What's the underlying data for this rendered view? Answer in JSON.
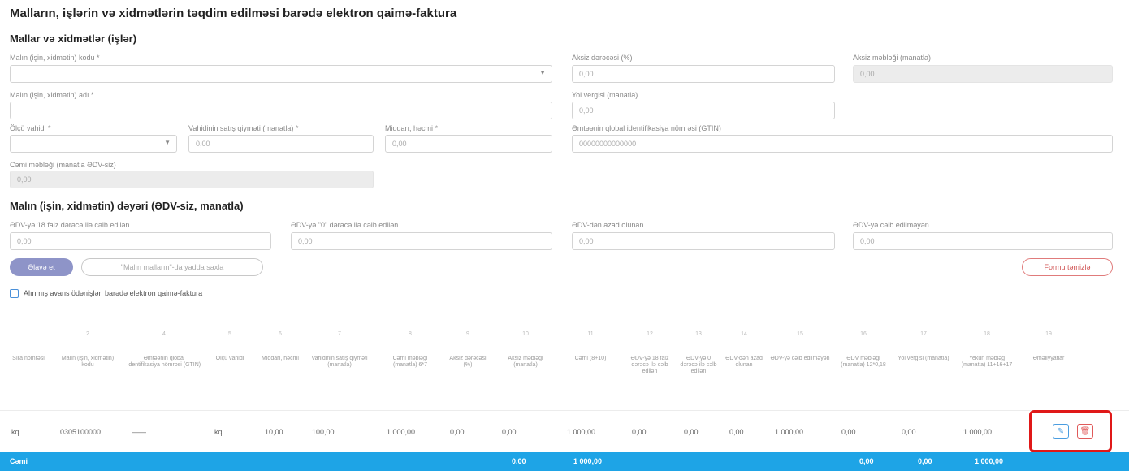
{
  "page_title": "Malların, işlərin və xidmətlərin təqdim edilməsi barədə elektron qaimə-faktura",
  "section1_title": "Mallar və xidmətlər (işlər)",
  "section2_title": "Malın (işin, xidmətin) dəyəri (ƏDV-siz, manatla)",
  "fields": {
    "code_label": "Malın (işin, xidmətin) kodu *",
    "discount_rate_label": "Aksiz dərəcəsi (%)",
    "discount_rate_value": "0,00",
    "discount_amount_label": "Aksiz məbləği (manatla)",
    "discount_amount_value": "0,00",
    "name_label": "Malın (işin, xidmətin) adı *",
    "road_tax_label": "Yol vergisi (manatla)",
    "road_tax_value": "0,00",
    "unit_label": "Ölçü vahidi *",
    "unit_price_label": "Vahidinin satış qiyməti (manatla) *",
    "unit_price_value": "0,00",
    "quantity_label": "Miqdarı, həcmi *",
    "quantity_value": "0,00",
    "gtin_label": "Əmtəənin qlobal identifikasiya nömrəsi (GTIN)",
    "gtin_value": "00000000000000",
    "total_label": "Cəmi məbləği (manatla ƏDV-siz)",
    "total_value": "0,00",
    "vat18_label": "ƏDV-yə 18 faiz dərəcə ilə cəlb edilən",
    "vat18_value": "0,00",
    "vat0_label": "ƏDV-yə \"0\" dərəcə ilə cəlb edilən",
    "vat0_value": "0,00",
    "vat_exempt_label": "ƏDV-dən azad olunan",
    "vat_exempt_value": "0,00",
    "vat_not_label": "ƏDV-yə cəlb edilməyən",
    "vat_not_value": "0,00"
  },
  "buttons": {
    "add": "Əlavə et",
    "list": "\"Malın malların\"-da yadda saxla",
    "clear": "Formu təmizlə"
  },
  "checkbox_label": "Alınmış avans ödənişləri barədə elektron qaimə-faktura",
  "table": {
    "col_numbers": [
      "2",
      "4",
      "5",
      "6",
      "7",
      "8",
      "9",
      "10",
      "11",
      "12",
      "13",
      "14",
      "15",
      "16",
      "17",
      "18",
      "19"
    ],
    "headers": [
      "Sıra nömrəsi",
      "Malın (işin, xidmətin) kodu",
      "Əmtəənin qlobal identifikasiya nömrəsi (GTIN)",
      "Ölçü vahidi",
      "Miqdarı, həcmi",
      "Vahidinin satış qiyməti (manatla)",
      "Cəmi məbləği (manatla) 6*7",
      "Aksiz dərəcəsi (%)",
      "Aksiz məbləği (manatla)",
      "Cəmi (8+10)",
      "ƏDV-yə 18 faiz dərəcə ilə cəlb edilən",
      "ƏDV-yə 0 dərəcə ilə cəlb edilən",
      "ƏDV-dən azad olunan",
      "ƏDV-yə cəlb edilməyən",
      "ƏDV məbləği (manatla) 12*0,18",
      "Yol vergisi (manatla)",
      "Yekun məbləğ (manatla) 11+16+17",
      "Əməliyyatlar"
    ],
    "row": [
      "kq",
      "0305100000",
      "——",
      "kq",
      "10,00",
      "100,00",
      "1 000,00",
      "0,00",
      "0,00",
      "1 000,00",
      "0,00",
      "0,00",
      "0,00",
      "1 000,00",
      "0,00",
      "0,00",
      "1 000,00"
    ],
    "totals": {
      "label": "Cəmi",
      "excise": "0,00",
      "sum": "1 000,00",
      "vat": "0,00",
      "road": "0,00",
      "final": "1 000,00"
    }
  },
  "colors": {
    "accent": "#1ea4e6",
    "primary_button": "#8e94c8",
    "danger": "#e01818"
  }
}
